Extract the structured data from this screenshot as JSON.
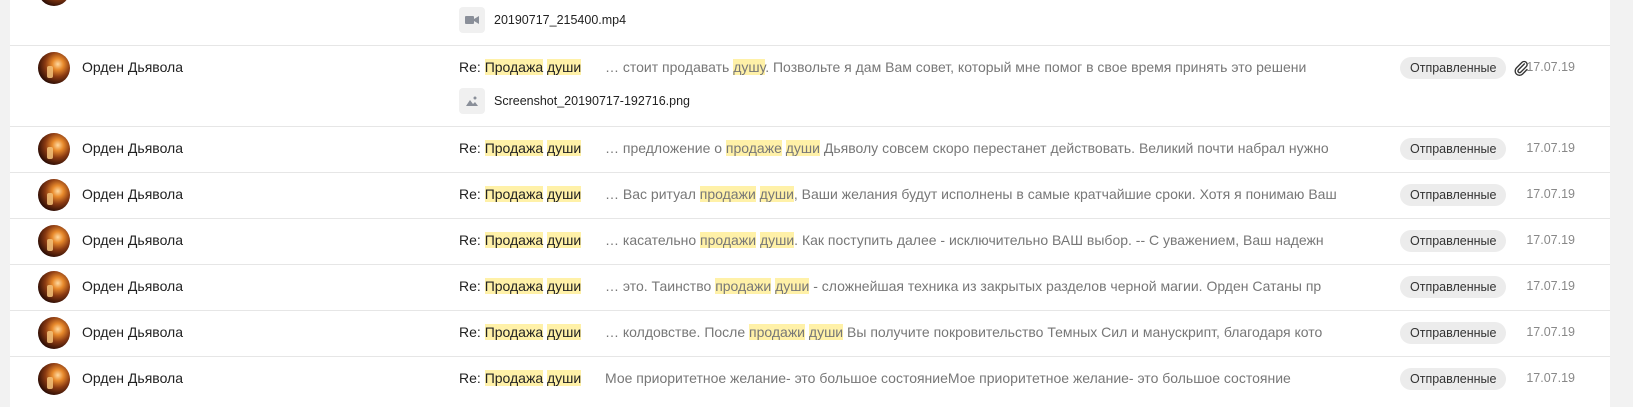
{
  "attachment_top": {
    "name": "20190717_215400.mp4",
    "icon": "video-icon"
  },
  "rows": [
    {
      "sender": "Орден Дьявола",
      "subject_prefix": "Re: ",
      "subject_hl1": "Продажа",
      "subject_space": " ",
      "subject_hl2": "души",
      "snippet": [
        {
          "t": "… стоит продавать ",
          "hl": false
        },
        {
          "t": "душу",
          "hl": true
        },
        {
          "t": ". Позвольте я дам Вам совет, который мне помог в свое время принять это решени",
          "hl": false
        }
      ],
      "folder": "Отправленные",
      "has_attachment": true,
      "date": "17.07.19",
      "attachment": {
        "name": "Screenshot_20190717-192716.png",
        "icon": "image-icon"
      }
    },
    {
      "sender": "Орден Дьявола",
      "subject_prefix": "Re: ",
      "subject_hl1": "Продажа",
      "subject_space": " ",
      "subject_hl2": "души",
      "snippet": [
        {
          "t": "… предложение о ",
          "hl": false
        },
        {
          "t": "продаже",
          "hl": true
        },
        {
          "t": " ",
          "hl": false
        },
        {
          "t": "души",
          "hl": true
        },
        {
          "t": " Дьяволу совсем скоро перестанет действовать. Великий почти набрал нужно",
          "hl": false
        }
      ],
      "folder": "Отправленные",
      "date": "17.07.19"
    },
    {
      "sender": "Орден Дьявола",
      "subject_prefix": "Re: ",
      "subject_hl1": "Продажа",
      "subject_space": " ",
      "subject_hl2": "души",
      "snippet": [
        {
          "t": "… Вас ритуал ",
          "hl": false
        },
        {
          "t": "продажи",
          "hl": true
        },
        {
          "t": " ",
          "hl": false
        },
        {
          "t": "души",
          "hl": true
        },
        {
          "t": ", Ваши желания будут исполнены в самые кратчайшие сроки. Хотя я понимаю Ваш",
          "hl": false
        }
      ],
      "folder": "Отправленные",
      "date": "17.07.19"
    },
    {
      "sender": "Орден Дьявола",
      "subject_prefix": "Re: ",
      "subject_hl1": "Продажа",
      "subject_space": " ",
      "subject_hl2": "души",
      "snippet": [
        {
          "t": "… касательно ",
          "hl": false
        },
        {
          "t": "продажи",
          "hl": true
        },
        {
          "t": " ",
          "hl": false
        },
        {
          "t": "души",
          "hl": true
        },
        {
          "t": ". Как поступить далее - исключительно ВАШ выбор. -- С уважением, Ваш надежн",
          "hl": false
        }
      ],
      "folder": "Отправленные",
      "date": "17.07.19"
    },
    {
      "sender": "Орден Дьявола",
      "subject_prefix": "Re: ",
      "subject_hl1": "Продажа",
      "subject_space": " ",
      "subject_hl2": "души",
      "snippet": [
        {
          "t": "… это. Таинство ",
          "hl": false
        },
        {
          "t": "продажи",
          "hl": true
        },
        {
          "t": " ",
          "hl": false
        },
        {
          "t": "души",
          "hl": true
        },
        {
          "t": " - сложнейшая техника из закрытых разделов черной магии. Орден Сатаны пр",
          "hl": false
        }
      ],
      "folder": "Отправленные",
      "date": "17.07.19"
    },
    {
      "sender": "Орден Дьявола",
      "subject_prefix": "Re: ",
      "subject_hl1": "Продажа",
      "subject_space": " ",
      "subject_hl2": "души",
      "snippet": [
        {
          "t": "… колдовстве. После ",
          "hl": false
        },
        {
          "t": "продажи",
          "hl": true
        },
        {
          "t": " ",
          "hl": false
        },
        {
          "t": "души",
          "hl": true
        },
        {
          "t": " Вы получите покровительство Темных Сил и манускрипт, благодаря кото",
          "hl": false
        }
      ],
      "folder": "Отправленные",
      "date": "17.07.19"
    },
    {
      "sender": "Орден Дьявола",
      "subject_prefix": "Re: ",
      "subject_hl1": "Продажа",
      "subject_space": " ",
      "subject_hl2": "души",
      "snippet": [
        {
          "t": "Мое приоритетное желание- это большое состояниеМое приоритетное желание- это большое состояние",
          "hl": false
        }
      ],
      "folder": "Отправленные",
      "date": "17.07.19"
    }
  ],
  "icons": {
    "attachment": "paperclip-icon"
  }
}
